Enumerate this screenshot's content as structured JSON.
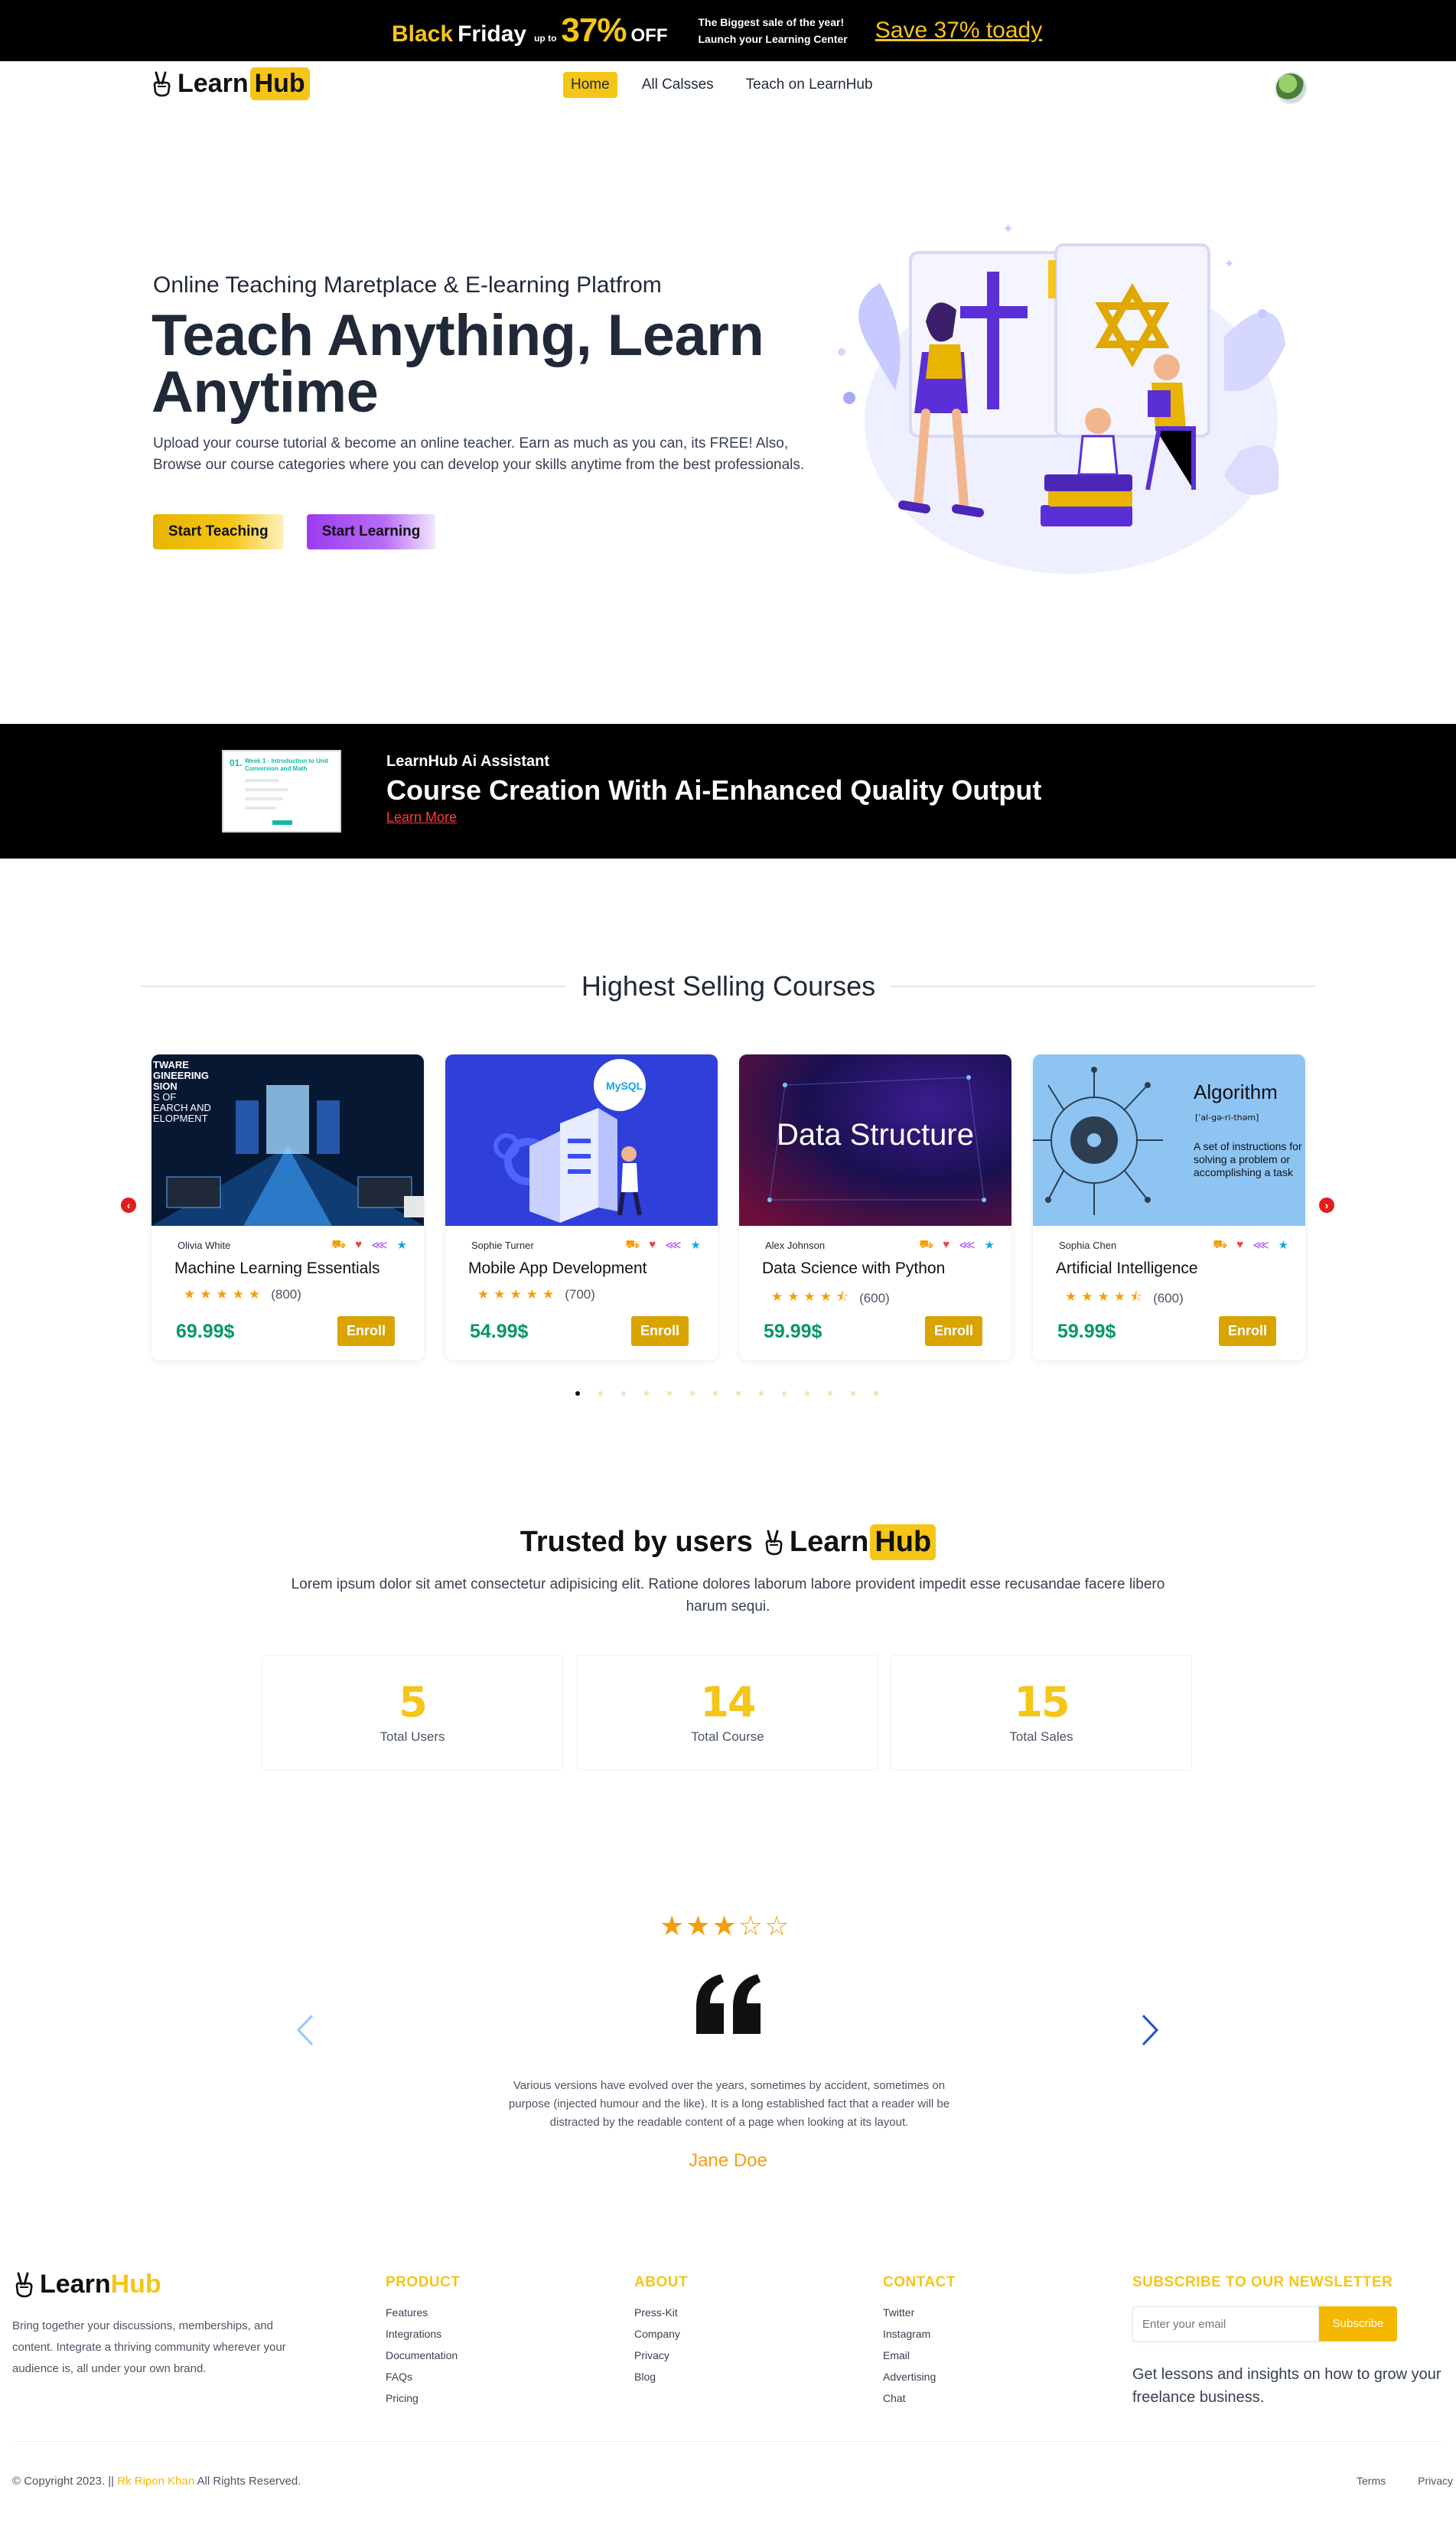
{
  "promo": {
    "black": "Black",
    "friday": "Friday",
    "upto": "up to",
    "percent": "37%",
    "off": "OFF",
    "line1": "The Biggest sale of the year!",
    "line2": "Launch your Learning Center",
    "save_link": "Save 37% toady"
  },
  "brand": {
    "learn": "Learn",
    "hub": "Hub"
  },
  "nav": {
    "links": [
      "Home",
      "All Calsses",
      "Teach on LearnHub"
    ],
    "active": "Home"
  },
  "hero": {
    "subtitle": "Online Teaching Maretplace & E-learning Platfrom",
    "title": "Teach Anything, Learn Anytime",
    "description": "Upload your course tutorial & become an online teacher. Earn as much as you can, its FREE! Also, Browse our course categories where you can develop your skills anytime from the best professionals.",
    "btn_teach": "Start Teaching",
    "btn_learn": "Start Learning"
  },
  "ai_banner": {
    "label": "LearnHub Ai Assistant",
    "title": "Course Creation With Ai-Enhanced Quality Output",
    "link": "Learn More",
    "thumb_num": "01.",
    "thumb_title": "Week 1 - Introduction to Unit Conversion and Math"
  },
  "courses": {
    "heading": "Highest Selling Courses",
    "items": [
      {
        "author": "Olivia White",
        "title": "Machine Learning Essentials",
        "stars": "★★★★★",
        "count": "(800)",
        "price": "69.99$",
        "enroll": "Enroll",
        "image_text": ""
      },
      {
        "author": "Sophie Turner",
        "title": "Mobile App Development",
        "stars": "★★★★★",
        "count": "(700)",
        "price": "54.99$",
        "enroll": "Enroll",
        "image_text": "MySQL"
      },
      {
        "author": "Alex Johnson",
        "title": "Data Science with Python",
        "stars": "★★★★⯪",
        "count": "(600)",
        "price": "59.99$",
        "enroll": "Enroll",
        "image_text": "Data Structure"
      },
      {
        "author": "Sophia Chen",
        "title": "Artificial Intelligence",
        "stars": "★★★★⯪",
        "count": "(600)",
        "price": "59.99$",
        "enroll": "Enroll",
        "image_text": "Algorithm"
      }
    ],
    "image1_lines": [
      "TWARE",
      "GINEERING",
      "SION",
      "S OF",
      "EARCH AND",
      "ELOPMENT"
    ],
    "image4_sub": "[ˈal-gə-ri-thəm]",
    "image4_desc": "A set of instructions for solving a problem or accomplishing a task",
    "dots_count": 14
  },
  "trusted": {
    "heading_prefix": "Trusted by users",
    "description": "Lorem ipsum dolor sit amet consectetur adipisicing elit. Ratione dolores laborum labore provident impedit esse recusandae facere libero harum sequi.",
    "stats": [
      {
        "value": "5",
        "label": "Total Users"
      },
      {
        "value": "14",
        "label": "Total Course"
      },
      {
        "value": "15",
        "label": "Total Sales"
      }
    ]
  },
  "testimonial": {
    "stars": "★★★☆☆",
    "rating": 3,
    "text": "Various versions have evolved over the years, sometimes by accident, sometimes on purpose (injected humour and the like). It is a long established fact that a reader will be distracted by the readable content of a page when looking at its layout.",
    "name": "Jane Doe"
  },
  "footer": {
    "description": "Bring together your discussions, memberships, and content. Integrate a thriving community wherever your audience is, all under your own brand.",
    "columns": [
      {
        "heading": "PRODUCT",
        "items": [
          "Features",
          "Integrations",
          "Documentation",
          "FAQs",
          "Pricing"
        ]
      },
      {
        "heading": "ABOUT",
        "items": [
          "Press-Kit",
          "Company",
          "Privacy",
          "Blog"
        ]
      },
      {
        "heading": "CONTACT",
        "items": [
          "Twitter",
          "Instagram",
          "Email",
          "Advertising",
          "Chat"
        ]
      }
    ],
    "newsletter_heading": "SUBSCRIBE TO OUR NEWSLETTER",
    "email_placeholder": "Enter your email",
    "subscribe": "Subscribe",
    "newsletter_desc": "Get lessons and insights on how to grow your freelance business.",
    "copyright_prefix": "© Copyright 2023. ||",
    "copyright_author": "Rk Ripon Khan",
    "copyright_suffix": "All Rights Reserved.",
    "legal": [
      "Terms",
      "Privacy"
    ]
  },
  "colors": {
    "accent": "#f5c518",
    "purple": "#9b3bf0",
    "price_green": "#059669",
    "enroll": "#d9a300",
    "promo_bg": "#000000"
  }
}
